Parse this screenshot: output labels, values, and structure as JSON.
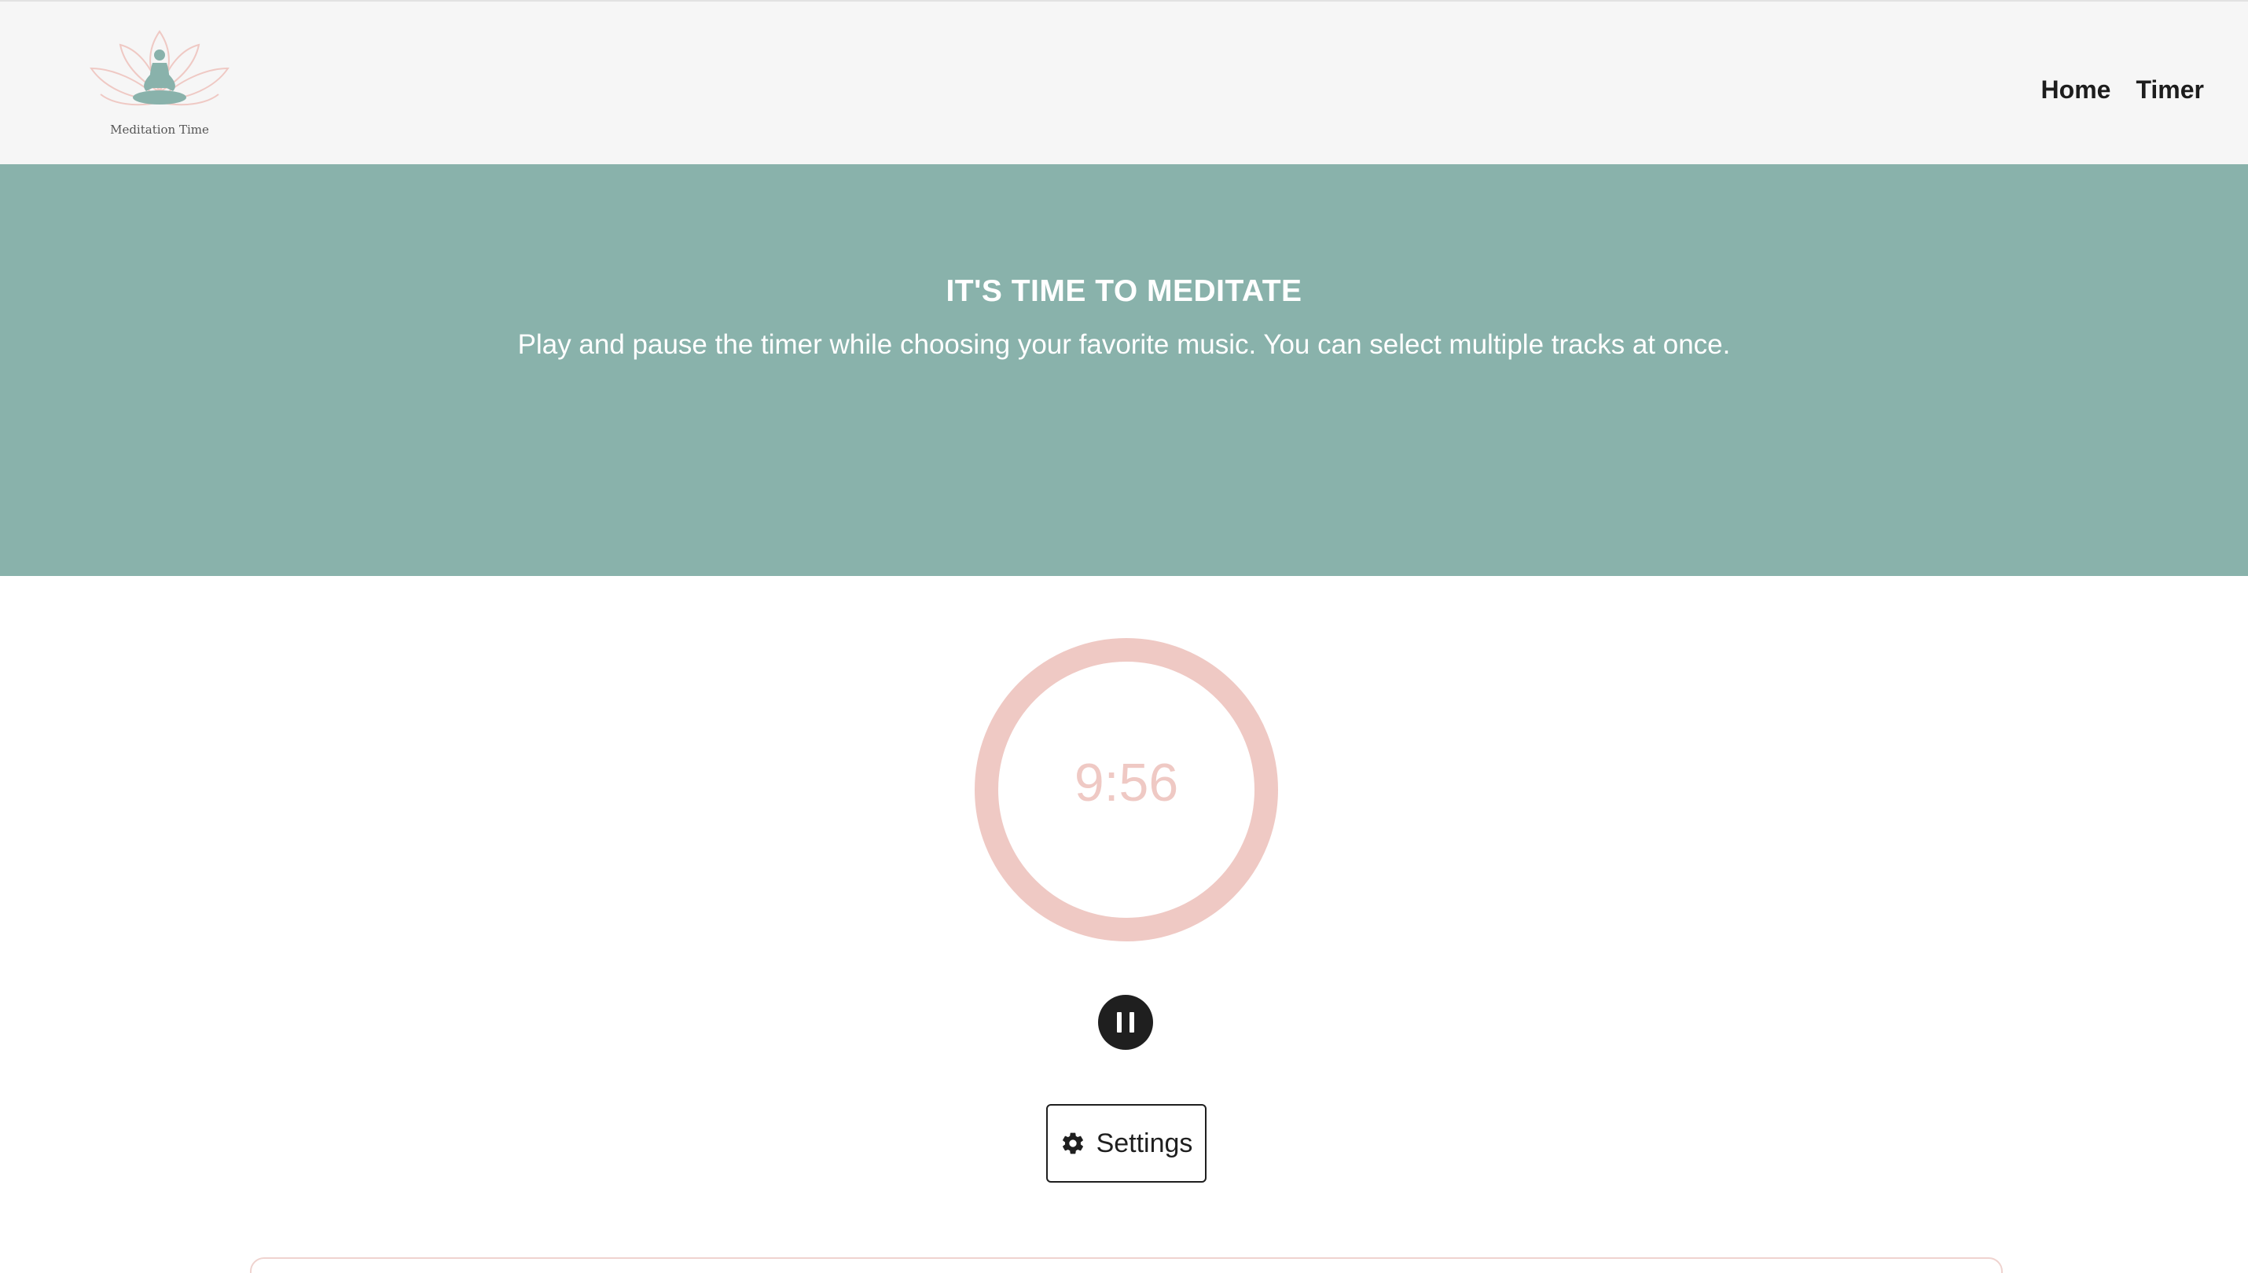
{
  "header": {
    "logo_text": "Meditation Time",
    "nav": [
      {
        "label": "Home"
      },
      {
        "label": "Timer"
      }
    ]
  },
  "hero": {
    "title": "IT'S TIME TO MEDITATE",
    "subtitle": "Play and pause the timer while choosing your favorite music. You can select multiple tracks at once."
  },
  "timer": {
    "display": "9:56",
    "ring_color": "#efc9c4",
    "state": "playing"
  },
  "controls": {
    "pause_icon": "pause-icon",
    "settings_label": "Settings",
    "settings_icon": "gear-icon"
  },
  "colors": {
    "hero_bg": "#89b2ab",
    "header_bg": "#f6f6f6",
    "accent_pink": "#efc9c4",
    "dark": "#1f1f1f"
  }
}
